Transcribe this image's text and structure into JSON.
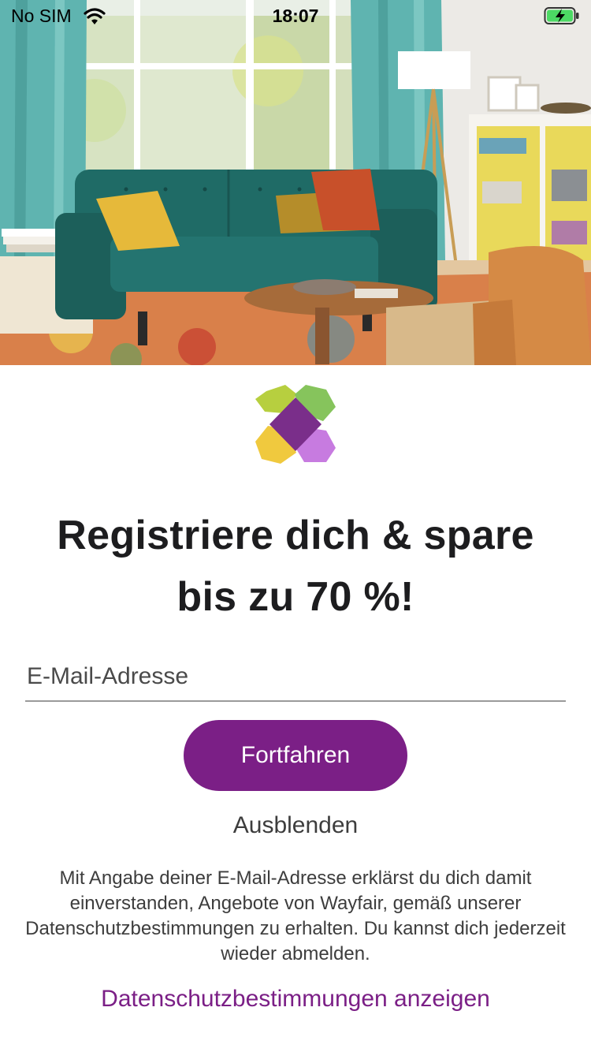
{
  "status_bar": {
    "carrier": "No SIM",
    "time": "18:07",
    "wifi_icon": "wifi-icon",
    "battery_icon": "battery-charging-icon"
  },
  "hero": {
    "image_icon": "living-room-photo"
  },
  "logo": {
    "icon": "wayfair-logo",
    "colors": [
      "#b7cf3f",
      "#86c45c",
      "#f0c93e",
      "#c77be0",
      "#7a2e8a"
    ]
  },
  "headline": {
    "line1": "Registriere dich & spare",
    "line2": "bis zu 70 %!"
  },
  "email": {
    "placeholder": "E-Mail-Adresse",
    "value": ""
  },
  "actions": {
    "continue_label": "Fortfahren",
    "hide_label": "Ausblenden"
  },
  "consent_text": "Mit Angabe deiner E-Mail-Adresse erklärst du dich damit einverstanden, Angebote von Wayfair, gemäß unserer Datenschutzbestimmungen zu erhalten. Du kannst dich jederzeit wieder abmelden.",
  "privacy_link": "Datenschutzbestimmungen anzeigen",
  "colors": {
    "brand_purple": "#7b1f86",
    "text_dark": "#1d1d1f",
    "text_gray": "#3d3d3d"
  }
}
